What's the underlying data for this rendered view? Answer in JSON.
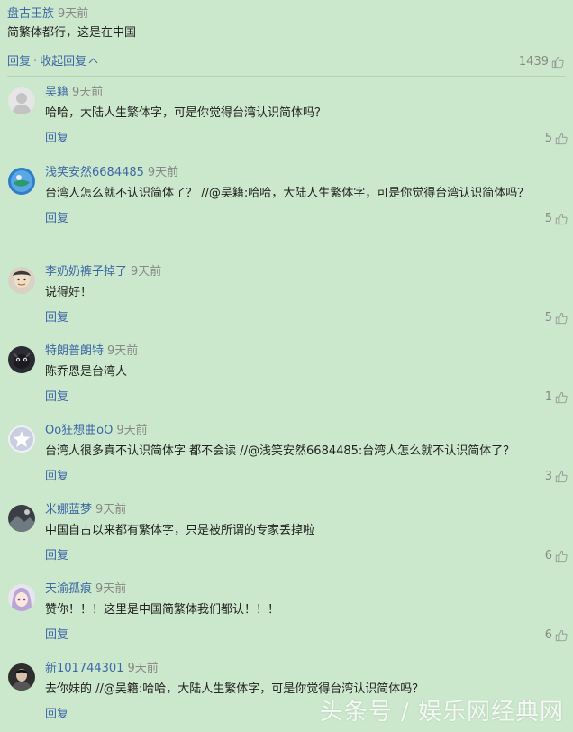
{
  "top_comment": {
    "username": "盘古王族",
    "time": "9天前",
    "text": "简繁体都行，这是在中国",
    "reply_label": "回复",
    "separator": "·",
    "collapse_label": "收起回复",
    "likes": "1439"
  },
  "replies": [
    {
      "username": "吴籍",
      "time": "9天前",
      "text": "哈哈，大陆人生繁体字，可是你觉得台湾认识简体吗？",
      "reply_label": "回复",
      "likes": "5",
      "avatar": "default-avatar"
    },
    {
      "username": "浅笑安然6684485",
      "time": "9天前",
      "text": "台湾人怎么就不认识简体了？ //@吴籍:哈哈，大陆人生繁体字，可是你觉得台湾认识简体吗？",
      "reply_label": "回复",
      "likes": "5",
      "avatar": "blue-round-avatar"
    },
    {
      "username": "李奶奶裤子掉了",
      "time": "9天前",
      "text": "说得好！",
      "reply_label": "回复",
      "likes": "5",
      "avatar": "face-avatar"
    },
    {
      "username": "特朗普朗特",
      "time": "9天前",
      "text": "陈乔恩是台湾人",
      "reply_label": "回复",
      "likes": "1",
      "avatar": "dark-animal-avatar"
    },
    {
      "username": "Oo狂想曲oO",
      "time": "9天前",
      "text": "台湾人很多真不认识简体字 都不会读 //@浅笑安然6684485:台湾人怎么就不认识简体了？",
      "reply_label": "回复",
      "likes": "3",
      "avatar": "star-avatar"
    },
    {
      "username": "米娜蓝梦",
      "time": "9天前",
      "text": "中国自古以来都有繁体字，只是被所谓的专家丢掉啦",
      "reply_label": "回复",
      "likes": "6",
      "avatar": "dark-photo-avatar"
    },
    {
      "username": "天渝孤痕",
      "time": "9天前",
      "text": "赞你！！！这里是中国简繁体我们都认！！！",
      "reply_label": "回复",
      "likes": "6",
      "avatar": "anime-avatar"
    },
    {
      "username": "新101744301",
      "time": "9天前",
      "text": "去你妹的 //@吴籍:哈哈，大陆人生繁体字，可是你觉得台湾认识简体吗？",
      "reply_label": "回复",
      "likes": "",
      "avatar": "portrait-avatar"
    }
  ],
  "watermark": "头条号 / 娱乐网经典网",
  "colors": {
    "background": "#cbe8cc",
    "link": "#3d68a6",
    "muted": "#888888"
  }
}
